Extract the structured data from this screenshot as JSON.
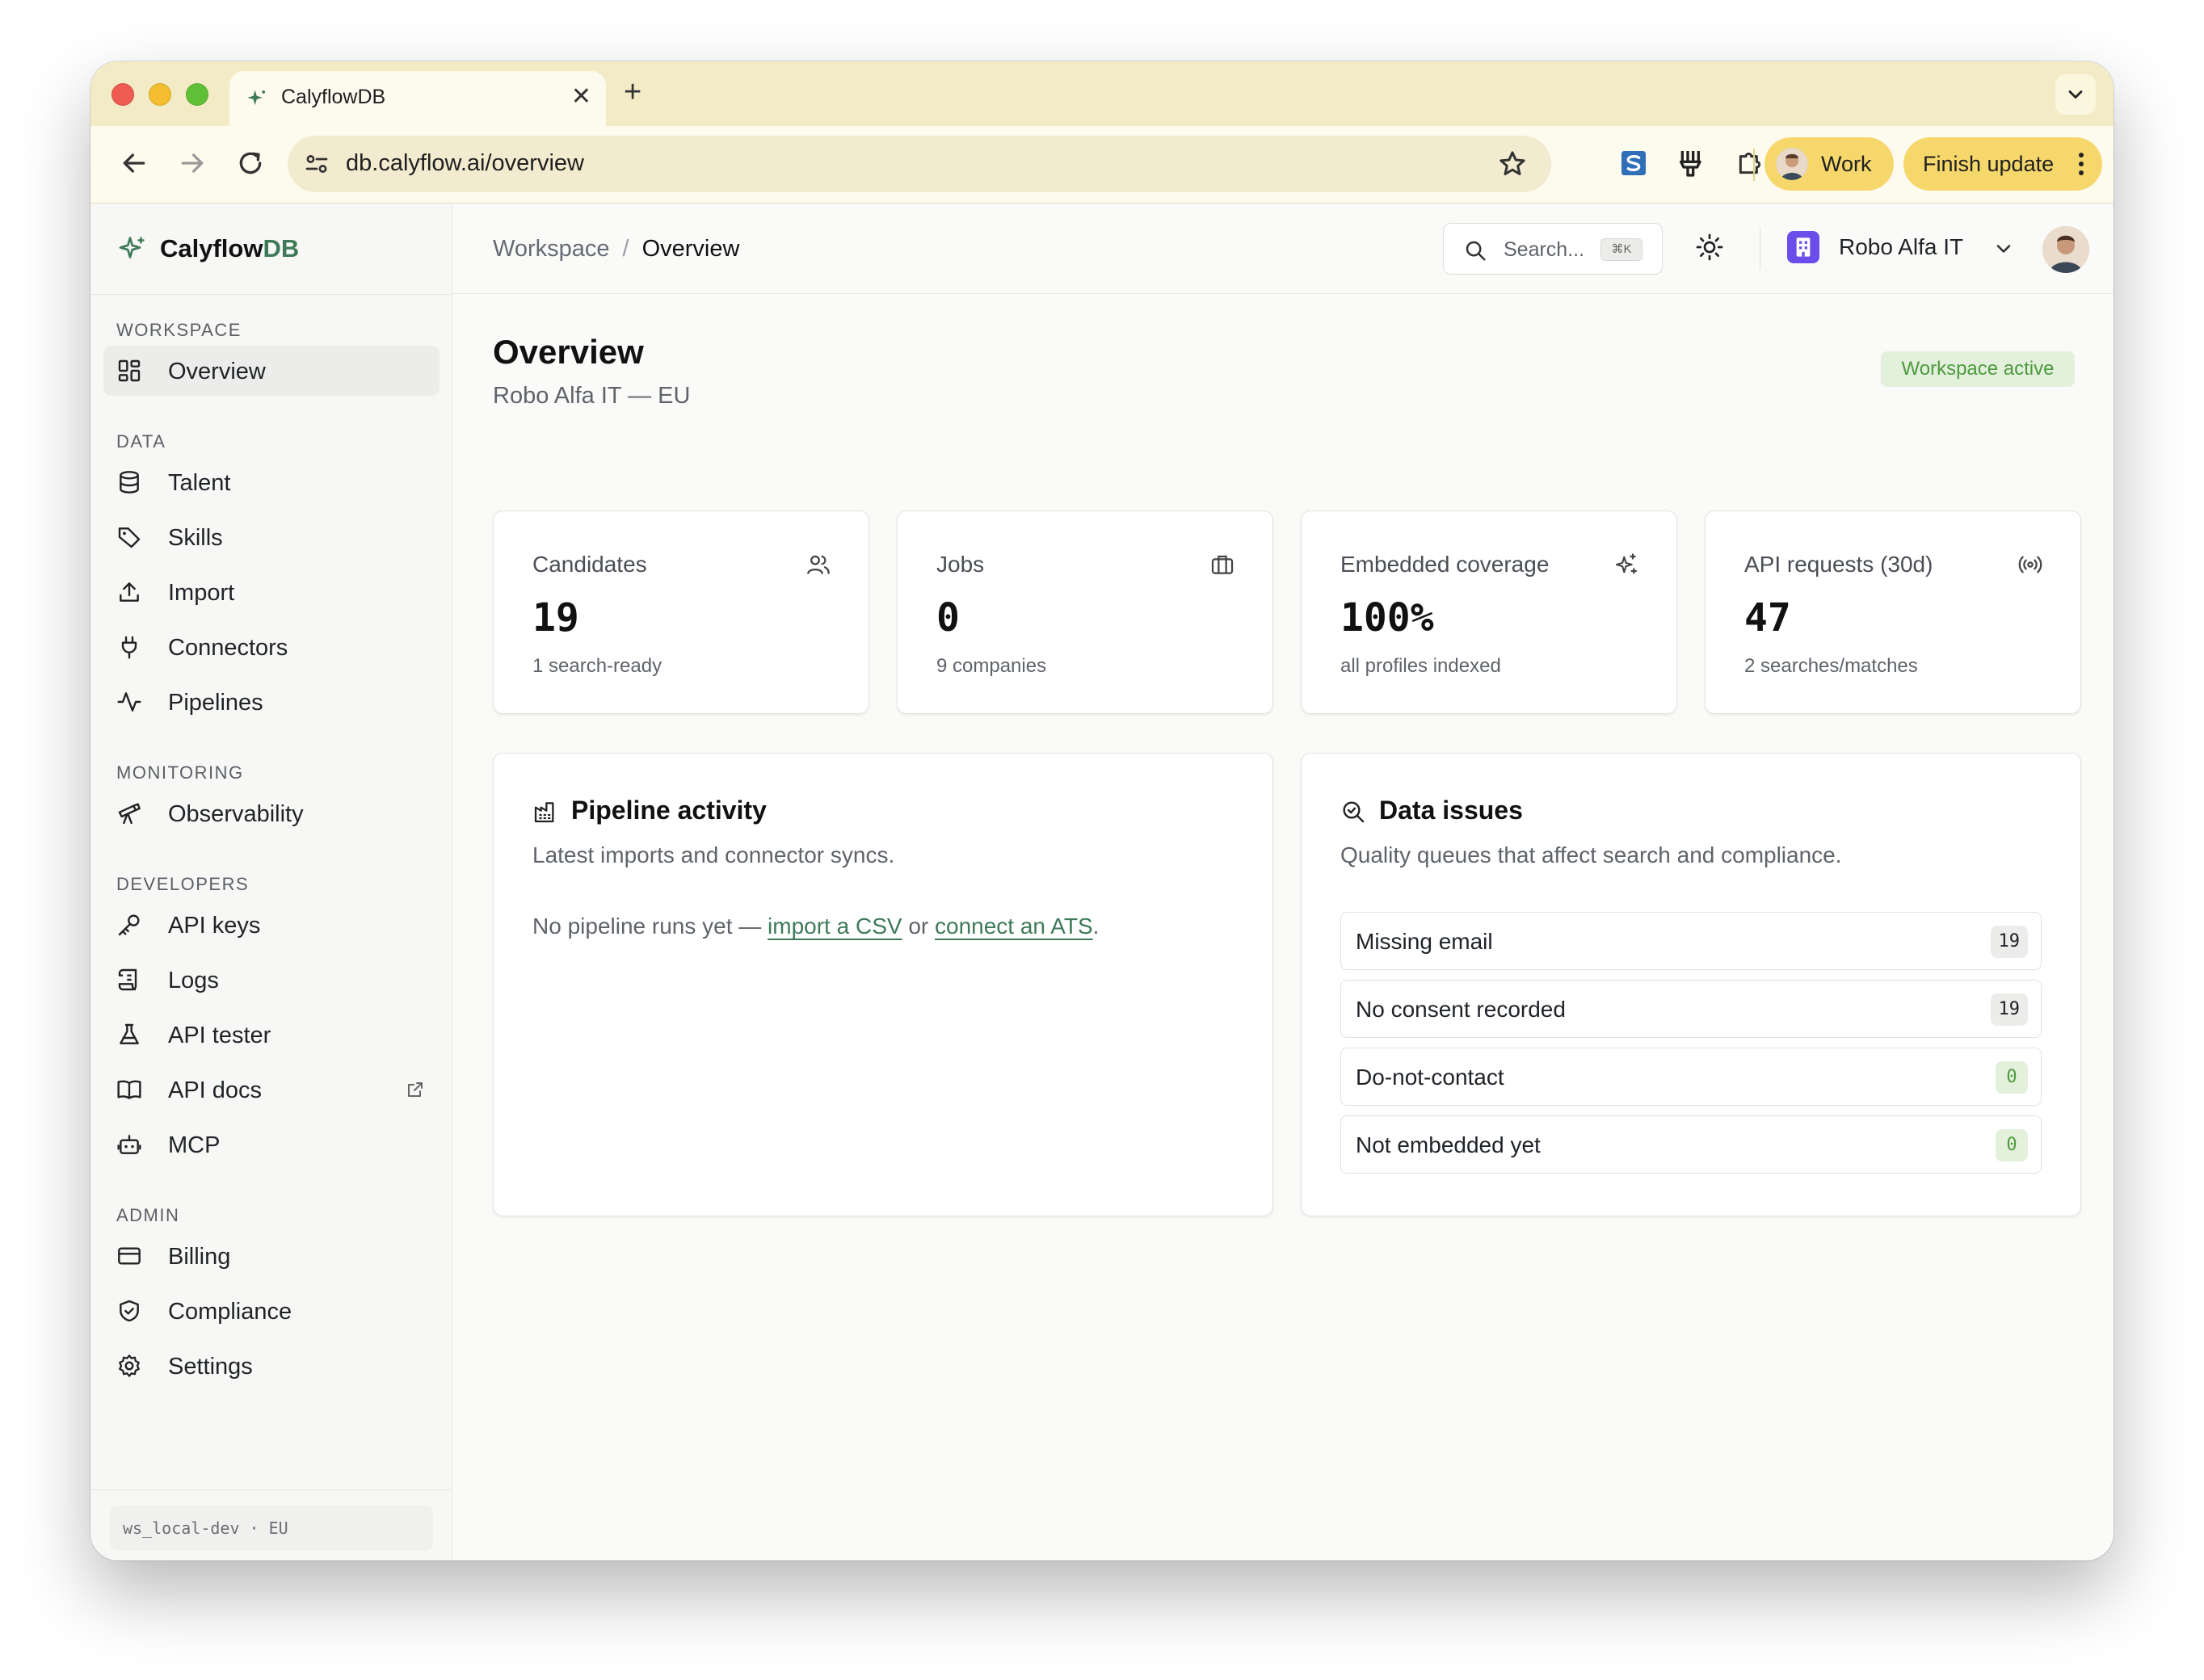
{
  "browser": {
    "tab_title": "CalyflowDB",
    "url": "db.calyflow.ai/overview",
    "profile_label": "Work",
    "update_label": "Finish update"
  },
  "sidebar": {
    "brand": {
      "name_main": "Calyflow",
      "name_accent": "DB"
    },
    "sections": [
      {
        "label": "WORKSPACE",
        "items": [
          {
            "label": "Overview",
            "icon": "grid-icon",
            "active": true
          }
        ]
      },
      {
        "label": "DATA",
        "items": [
          {
            "label": "Talent",
            "icon": "database-icon"
          },
          {
            "label": "Skills",
            "icon": "tag-icon"
          },
          {
            "label": "Import",
            "icon": "upload-icon"
          },
          {
            "label": "Connectors",
            "icon": "plug-icon"
          },
          {
            "label": "Pipelines",
            "icon": "activity-icon"
          }
        ]
      },
      {
        "label": "MONITORING",
        "items": [
          {
            "label": "Observability",
            "icon": "telescope-icon"
          }
        ]
      },
      {
        "label": "DEVELOPERS",
        "items": [
          {
            "label": "API keys",
            "icon": "key-icon"
          },
          {
            "label": "Logs",
            "icon": "scroll-icon"
          },
          {
            "label": "API tester",
            "icon": "flask-icon"
          },
          {
            "label": "API docs",
            "icon": "book-icon",
            "external": true
          },
          {
            "label": "MCP",
            "icon": "bot-icon"
          }
        ]
      },
      {
        "label": "ADMIN",
        "items": [
          {
            "label": "Billing",
            "icon": "credit-card-icon"
          },
          {
            "label": "Compliance",
            "icon": "shield-icon"
          },
          {
            "label": "Settings",
            "icon": "gear-icon"
          }
        ]
      }
    ],
    "workspace_id": "ws_local-dev · EU"
  },
  "header": {
    "breadcrumb_root": "Workspace",
    "breadcrumb_sep": "/",
    "breadcrumb_current": "Overview",
    "search_placeholder": "Search...",
    "search_shortcut": "⌘K",
    "org_name": "Robo Alfa IT"
  },
  "page": {
    "title": "Overview",
    "subtitle": "Robo Alfa IT — EU",
    "status": "Workspace active",
    "status_color": "#4e9a3f"
  },
  "stats": [
    {
      "label": "Candidates",
      "value": "19",
      "note": "1 search-ready",
      "icon": "users-icon"
    },
    {
      "label": "Jobs",
      "value": "0",
      "note": "9 companies",
      "icon": "briefcase-icon"
    },
    {
      "label": "Embedded coverage",
      "value": "100%",
      "note": "all profiles indexed",
      "icon": "sparkles-icon"
    },
    {
      "label": "API requests (30d)",
      "value": "47",
      "note": "2 searches/matches",
      "icon": "broadcast-icon"
    }
  ],
  "pipeline": {
    "title": "Pipeline activity",
    "subtitle": "Latest imports and connector syncs.",
    "empty_prefix": "No pipeline runs yet — ",
    "link_import": "import a CSV",
    "empty_mid": " or ",
    "link_connect": "connect an ATS",
    "empty_suffix": "."
  },
  "issues": {
    "title": "Data issues",
    "subtitle": "Quality queues that affect search and compliance.",
    "rows": [
      {
        "label": "Missing email",
        "count": "19",
        "state": "warn"
      },
      {
        "label": "No consent recorded",
        "count": "19",
        "state": "warn"
      },
      {
        "label": "Do-not-contact",
        "count": "0",
        "state": "ok"
      },
      {
        "label": "Not embedded yet",
        "count": "0",
        "state": "ok"
      }
    ]
  },
  "colors": {
    "accent": "#3e7a58",
    "chrome": "#f2ebc5",
    "update_pill": "#f6d76c",
    "org_icon": "#6b4eea"
  }
}
